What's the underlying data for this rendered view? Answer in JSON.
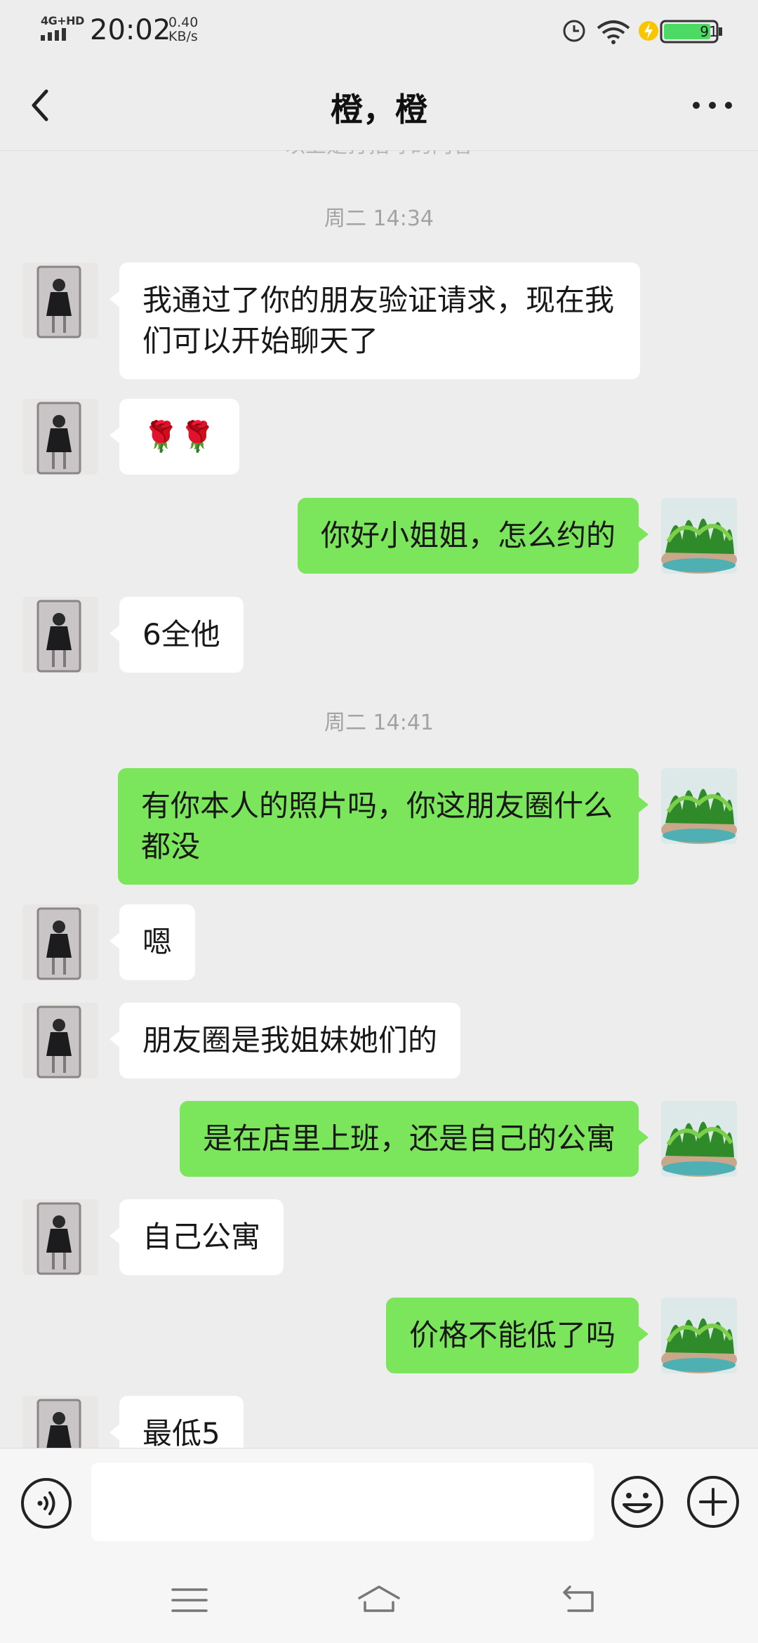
{
  "status_bar": {
    "network": "4G+HD",
    "time": "20:02",
    "speed_value": "0.40",
    "speed_unit": "KB/s",
    "battery": "91"
  },
  "header": {
    "title": "橙，橙"
  },
  "chat": {
    "cut_off_note": "以上是打招呼的内容",
    "items": [
      {
        "kind": "time",
        "text": "周二 14:34"
      },
      {
        "kind": "msg",
        "side": "left",
        "text": "我通过了你的朋友验证请求，现在我们可以开始聊天了"
      },
      {
        "kind": "msg",
        "side": "left",
        "text": "🌹🌹"
      },
      {
        "kind": "msg",
        "side": "right",
        "text": "你好小姐姐，怎么约的"
      },
      {
        "kind": "msg",
        "side": "left",
        "text": "6全他"
      },
      {
        "kind": "time",
        "text": "周二 14:41"
      },
      {
        "kind": "msg",
        "side": "right",
        "text": "有你本人的照片吗，你这朋友圈什么都没"
      },
      {
        "kind": "msg",
        "side": "left",
        "text": "嗯"
      },
      {
        "kind": "msg",
        "side": "left",
        "text": "朋友圈是我姐妹她们的"
      },
      {
        "kind": "msg",
        "side": "right",
        "text": "是在店里上班，还是自己的公寓"
      },
      {
        "kind": "msg",
        "side": "left",
        "text": "自己公寓"
      },
      {
        "kind": "msg",
        "side": "right",
        "text": "价格不能低了吗"
      },
      {
        "kind": "msg",
        "side": "left",
        "text": "最低5"
      }
    ]
  },
  "input": {
    "value": "",
    "icons": [
      "voice-icon",
      "emoji-icon",
      "plus-icon"
    ]
  },
  "system_nav": {
    "icons": [
      "menu-icon",
      "home-icon",
      "back-icon"
    ]
  },
  "colors": {
    "background": "#ededed",
    "sent_bubble": "#7be55b",
    "received_bubble": "#ffffff",
    "battery_green": "#4cd964"
  }
}
